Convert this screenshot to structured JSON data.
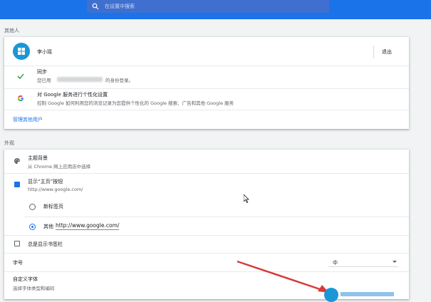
{
  "search": {
    "placeholder": "在设置中搜索"
  },
  "people": {
    "section_title": "其他人",
    "profile_name": "李小瑶",
    "signout_label": "退出",
    "sync_title": "同步",
    "sync_subtitle_prefix": "您已用",
    "sync_subtitle_suffix": "的身份登录。",
    "personalize_title": "对 Google 服务进行个性化设置",
    "personalize_subtitle": "控制 Google 如何利用您的浏览记录为您提供个性化的 Google 搜索、广告和其他 Google 服务",
    "manage_link": "管理其他用户"
  },
  "appearance": {
    "section_title": "外观",
    "theme_title": "主题背景",
    "theme_subtitle": "从 Chrome 网上应用店中选择",
    "home_button_title": "显示“主页”按钮",
    "home_button_subtitle": "http://www.google.com/",
    "home_button_checked": true,
    "radio_new_tab": "新标签页",
    "radio_other": "其他",
    "radio_other_value": "http://www.google.com/",
    "selected_radio": "other",
    "bookmarks_bar": "总是显示书签栏",
    "bookmarks_bar_checked": false,
    "font_size_label": "字号",
    "font_size_value": "中",
    "custom_fonts_title": "自定义字体",
    "custom_fonts_subtitle": "选择字体类型和编码"
  },
  "colors": {
    "accent": "#1a73e8",
    "annotation_arrow": "#d83a3a"
  }
}
